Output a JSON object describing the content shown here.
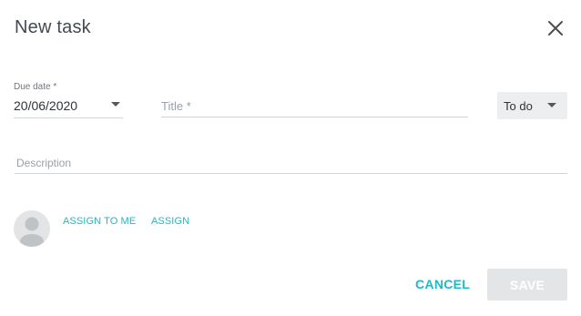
{
  "dialog": {
    "title": "New task",
    "close_icon": "close-icon"
  },
  "fields": {
    "due_date": {
      "label": "Due date *",
      "value": "20/06/2020",
      "icon": "chevron-down-icon"
    },
    "title": {
      "placeholder": "Title *",
      "value": ""
    },
    "status": {
      "value": "To do",
      "icon": "chevron-down-icon"
    },
    "description": {
      "placeholder": "Description",
      "value": ""
    }
  },
  "assignee": {
    "avatar_icon": "avatar-placeholder-icon",
    "assign_to_me_label": "ASSIGN TO ME",
    "assign_label": "ASSIGN"
  },
  "actions": {
    "cancel_label": "CANCEL",
    "save_label": "SAVE",
    "save_enabled": false
  },
  "colors": {
    "accent": "#1fb8c7",
    "disabled_button": "#e3e5e6",
    "title_text": "#444a4f",
    "placeholder_text": "#9aa0a5",
    "divider": "#d0d4d7"
  }
}
